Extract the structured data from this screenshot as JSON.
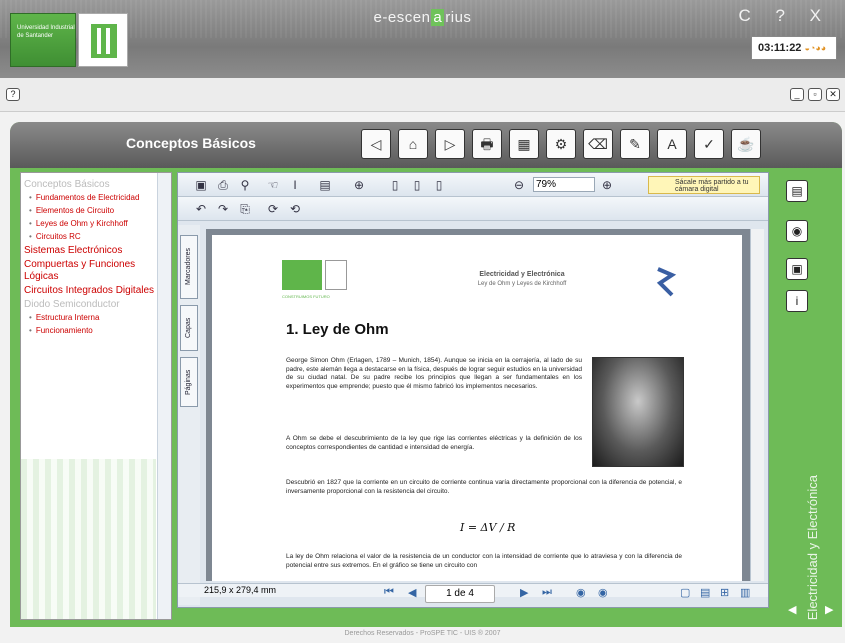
{
  "window": {
    "app_title_left": "e-escen",
    "app_title_box": "a",
    "app_title_right": "rius",
    "controls": "C ? X",
    "clock": "03:11:22",
    "university_label": "Universidad Industrial de Santander",
    "help_button": "?"
  },
  "toolbar_main": {
    "section_title": "Conceptos Básicos"
  },
  "left_nav": {
    "items": [
      {
        "type": "head",
        "label": "Conceptos Básicos",
        "gray": true
      },
      {
        "type": "item",
        "label": "Fundamentos de Electricidad"
      },
      {
        "type": "item",
        "label": "Elementos de Circuito"
      },
      {
        "type": "item",
        "label": "Leyes de Ohm y Kirchhoff"
      },
      {
        "type": "item",
        "label": "Circuitos RC"
      },
      {
        "type": "head",
        "label": "Sistemas Electrónicos"
      },
      {
        "type": "head",
        "label": "Compuertas y Funciones Lógicas"
      },
      {
        "type": "head",
        "label": "Circuitos Integrados Digitales"
      },
      {
        "type": "head",
        "label": "Diodo Semiconductor",
        "gray": true
      },
      {
        "type": "item",
        "label": "Estructura Interna"
      },
      {
        "type": "item",
        "label": "Funcionamiento"
      }
    ]
  },
  "viewer": {
    "zoom": "79%",
    "promo_text": "Sácale más partido a tu cámara digital",
    "side_tabs": [
      "Marcadores",
      "Capas",
      "Páginas"
    ],
    "page_size": "215,9 x 279,4 mm",
    "page_indicator": "1 de 4"
  },
  "document": {
    "logo_caption": "CONSTRUIMOS FUTURO",
    "header_title": "Electricidad y Electrónica",
    "header_sub": "Ley de Ohm y Leyes de Kirchhoff",
    "heading": "1.  Ley de Ohm",
    "para1": "George Simon Ohm (Erlagen, 1789 – Munich, 1854). Aunque se inicia en la cerrajería, al lado de su padre, este alemán llega a destacarse en la física, después de lograr seguir estudios en la universidad de su ciudad natal. De su padre recibe los principios que llegan a ser fundamentales en los experimentos que emprende; puesto que él mismo fabricó los implementos necesarios.",
    "para2": "A Ohm se debe el descubrimiento de la ley que rige las corrientes eléctricas y la definición de los conceptos correspondientes de cantidad e intensidad de energía.",
    "para3": "Descubrió en 1827 que la corriente en un circuito de corriente continua varía directamente proporcional con la diferencia de potencial, e inversamente proporcional con la resistencia del circuito.",
    "formula": "I = ΔV / R",
    "para4": "La ley de Ohm relaciona el valor de la resistencia de un conductor con la intensidad de corriente que lo atraviesa y con la diferencia de potencial entre sus extremos. En el gráfico se tiene un circuito con"
  },
  "side_label": "Electricidad y Electrónica",
  "footer": "Derechos Reservados - ProSPE TIC - UIS ® 2007"
}
